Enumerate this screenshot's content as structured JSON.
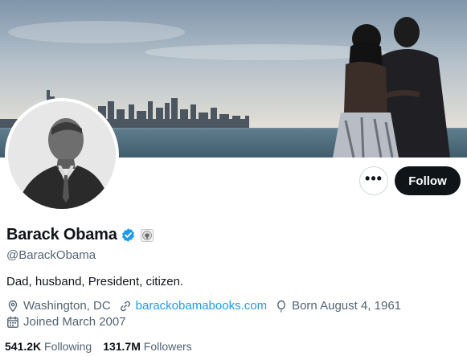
{
  "profile": {
    "display_name": "Barack Obama",
    "handle": "@BarackObama",
    "bio": "Dad, husband, President, citizen.",
    "location": "Washington, DC",
    "website": "barackobamabooks.com",
    "birthday": "Born August 4, 1961",
    "joined": "Joined March 2007",
    "following_count": "541.2K",
    "following_label": "Following",
    "followers_count": "131.7M",
    "followers_label": "Followers"
  },
  "actions": {
    "more_label": "•••",
    "follow_label": "Follow"
  },
  "icons": {
    "verified": "verified-badge-icon",
    "affiliation": "government-seal-icon",
    "location": "location-pin-icon",
    "link": "link-icon",
    "birthday": "balloon-icon",
    "joined": "calendar-icon"
  },
  "colors": {
    "accent": "#1d9bf0",
    "text_primary": "#0f1419",
    "text_secondary": "#536471",
    "follow_button_bg": "#0f1419"
  }
}
